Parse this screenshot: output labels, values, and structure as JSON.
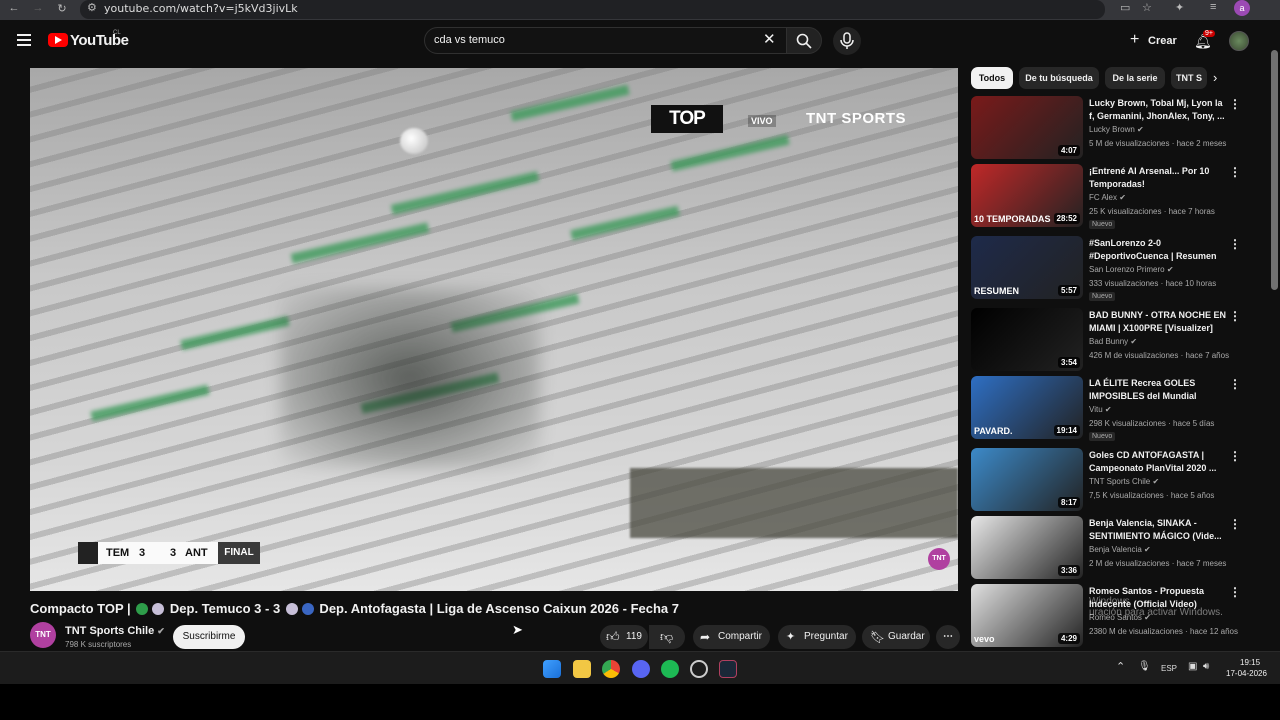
{
  "browser": {
    "url": "youtube.com/watch?v=j5kVd3jivLk",
    "profile_initial": "a"
  },
  "header": {
    "brand": "YouTube",
    "country": "CL",
    "search_value": "cda vs temuco",
    "create_label": "Crear",
    "notif_badge": "9+"
  },
  "player": {
    "overlay_logo": "TOP",
    "vivo": "VIVO",
    "broadcaster": "TNT SPORTS",
    "score": {
      "home": "TEM",
      "home_goals": "3",
      "away_goals": "3",
      "away": "ANT",
      "status": "FINAL"
    },
    "corner_badge": "TNT"
  },
  "video": {
    "title_a": "Compacto TOP | ",
    "title_b": " Dep. Temuco 3 - 3 ",
    "title_c": " Dep. Antofagasta | Liga de Ascenso Caixun 2026 - Fecha 7",
    "channel": "TNT Sports Chile",
    "subscribers": "798 K suscriptores",
    "subscribe_label": "Suscribirme",
    "likes": "119",
    "share_label": "Compartir",
    "ask_label": "Preguntar",
    "save_label": "Guardar"
  },
  "chips": [
    "Todos",
    "De tu búsqueda",
    "De la serie",
    "TNT S"
  ],
  "recommendations": [
    {
      "title": "Lucky Brown, Tobal Mj, Lyon la f, Germanini, JhonAlex, Tony, ...",
      "channel": "Lucky Brown",
      "meta": "5 M de visualizaciones · hace 2 meses",
      "duration": "4:07",
      "badge": "",
      "thumb_color": "#7a1a1a",
      "thumb_label": ""
    },
    {
      "title": "¡Entrené Al Arsenal... Por 10 Temporadas!",
      "channel": "FC Alex",
      "meta": "25 K visualizaciones · hace 7 horas",
      "duration": "28:52",
      "badge": "Nuevo",
      "thumb_color": "#c02828",
      "thumb_label": "10 TEMPORADAS"
    },
    {
      "title": "#SanLorenzo 2-0 #DeportivoCuenca | Resumen",
      "channel": "San Lorenzo Primero",
      "meta": "333 visualizaciones · hace 10 horas",
      "duration": "5:57",
      "badge": "Nuevo",
      "thumb_color": "#1e2a4a",
      "thumb_label": "RESUMEN"
    },
    {
      "title": "BAD BUNNY - OTRA NOCHE EN MIAMI | X100PRE [Visualizer]",
      "channel": "Bad Bunny",
      "meta": "426 M de visualizaciones · hace 7 años",
      "duration": "3:54",
      "badge": "",
      "thumb_color": "#000000",
      "thumb_label": ""
    },
    {
      "title": "LA ÉLITE Recrea GOLES IMPOSIBLES del Mundial",
      "channel": "Vitu",
      "meta": "298 K visualizaciones · hace 5 días",
      "duration": "19:14",
      "badge": "Nuevo",
      "thumb_color": "#2e6fc4",
      "thumb_label": "PAVARD."
    },
    {
      "title": "Goles CD ANTOFAGASTA | Campeonato PlanVital 2020 ...",
      "channel": "TNT Sports Chile",
      "meta": "7,5 K visualizaciones · hace 5 años",
      "duration": "8:17",
      "badge": "",
      "thumb_color": "#3c8ac9",
      "thumb_label": ""
    },
    {
      "title": "Benja Valencia, SINAKA - SENTIMIENTO MÁGICO (Vide...",
      "channel": "Benja Valencia",
      "meta": "2 M de visualizaciones · hace 7 meses",
      "duration": "3:36",
      "badge": "",
      "thumb_color": "#e8e8e8",
      "thumb_label": ""
    },
    {
      "title": "Romeo Santos - Propuesta Indecente (Official Video)",
      "channel": "Romeo Santos",
      "meta": "2380 M de visualizaciones · hace 12 años",
      "duration": "4:29",
      "badge": "",
      "thumb_color": "#e0e0e0",
      "thumb_label": "vevo"
    }
  ],
  "watermark": {
    "line1": "Windows",
    "line2": "uración para activar Windows."
  },
  "tray": {
    "lang": "ESP",
    "time": "19:15",
    "date": "17-04-2026"
  },
  "colors": {
    "accent": "#ff0000",
    "background": "#0f0f0f",
    "chip": "#272727"
  }
}
